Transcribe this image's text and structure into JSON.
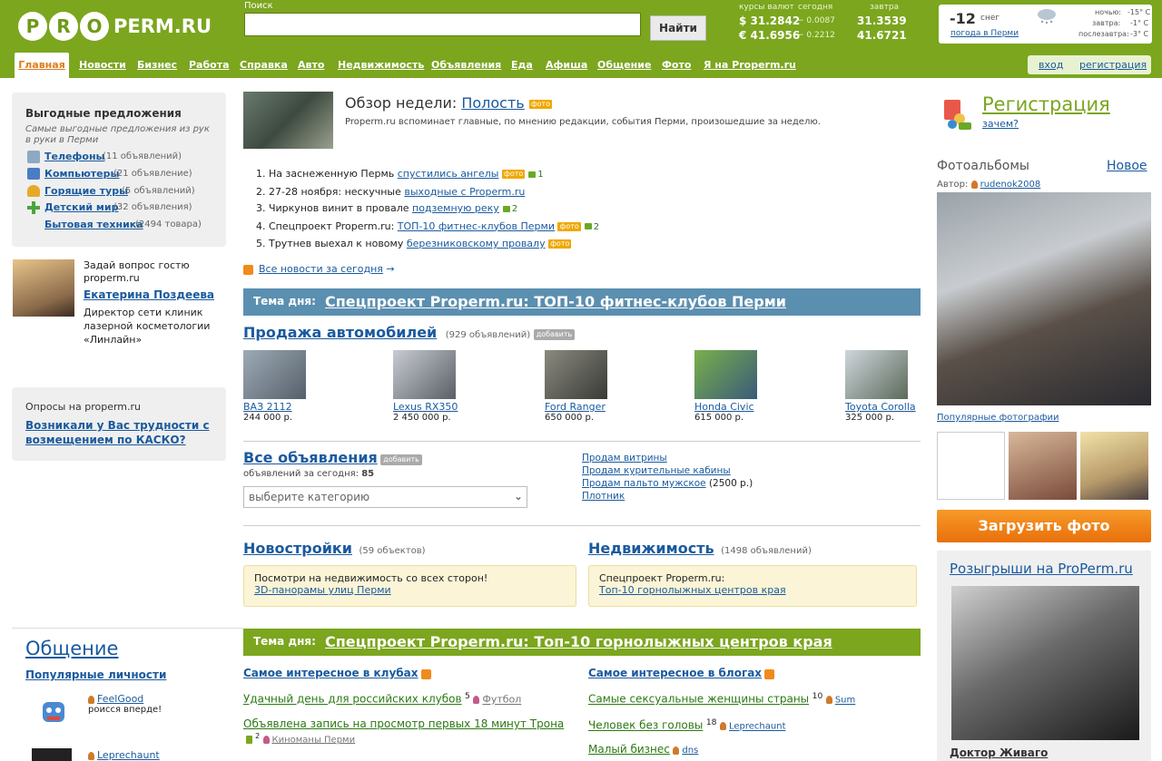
{
  "header": {
    "logo_letters": [
      "P",
      "R",
      "O"
    ],
    "logo_domain": "PERM.RU",
    "search_label": "Поиск",
    "search_button": "Найти",
    "currency": {
      "head_rates": "курсы валют",
      "head_today": "сегодня",
      "head_tomorrow": "завтра",
      "rows": [
        {
          "cur": "$ 31.2842",
          "chg": "− 0.0087",
          "tomorrow": "31.3539"
        },
        {
          "cur": "€ 41.6956",
          "chg": "− 0.2212",
          "tomorrow": "41.6721"
        }
      ]
    },
    "weather": {
      "temp": "-12",
      "desc": "снег",
      "link": "погода в Перми",
      "rows": [
        {
          "label": "ночью:",
          "val": "-15° C"
        },
        {
          "label": "завтра:",
          "val": "-1° C"
        },
        {
          "label": "послезавтра:",
          "val": "-3° C"
        }
      ]
    }
  },
  "nav": {
    "items": [
      "Главная",
      "Новости",
      "Бизнес",
      "Работа",
      "Справка",
      "Авто",
      "Недвижимость",
      "Объявления",
      "Еда",
      "Афиша",
      "Общение",
      "Фото",
      "Я на Properm.ru"
    ],
    "login": "вход",
    "register": "регистрация"
  },
  "left": {
    "offers_title": "Выгодные предложения",
    "offers_sub": "Самые выгодные предложения из рук в руки в Перми",
    "offers": [
      {
        "label": "Телефоны",
        "count": "(11 объявлений)"
      },
      {
        "label": "Компьютеры",
        "count": "(21 объявление)"
      },
      {
        "label": "Горящие туры",
        "count": "(5 объявлений)"
      },
      {
        "label": "Детский мир",
        "count": "(32 объявления)"
      },
      {
        "label": "Бытовая техника",
        "count": "(2494 товара)"
      }
    ],
    "guest_q": "Задай вопрос гостю properm.ru",
    "guest_name": "Екатерина Поздеева",
    "guest_desc": "Директор сети клиник лазерной косметологии «Линлайн»",
    "poll_title": "Опросы на properm.ru",
    "poll_q": "Возникали у Вас трудности с возмещением по КАСКО?"
  },
  "review": {
    "title": "Обзор недели:",
    "link": "Полость",
    "foto": "фото",
    "text": "Properm.ru вспоминает главные, по мнению редакции, события Перми, произошедшие за неделю.",
    "items": [
      {
        "pre": "1. На заснеженную Пермь ",
        "link": "спустились ангелы",
        "foto": "фото",
        "cmt": "1"
      },
      {
        "pre": "2. 27-28 ноября: нескучные ",
        "link": "выходные с Properm.ru",
        "foto": "",
        "cmt": ""
      },
      {
        "pre": "3. Чиркунов винит в провале ",
        "link": "подземную реку",
        "foto": "",
        "cmt": "2"
      },
      {
        "pre": "4. Спецпроект Properm.ru: ",
        "link": "ТОП-10 фитнес-клубов Перми",
        "foto": "фото",
        "cmt": "2"
      },
      {
        "pre": "5. Трутнев выехал к новому ",
        "link": "березниковскому провалу",
        "foto": "фото",
        "cmt": ""
      }
    ],
    "all_news": "Все новости за сегодня"
  },
  "theme1": {
    "label": "Тема дня:",
    "link": "Спецпроект Properm.ru: ТОП-10 фитнес-клубов Перми"
  },
  "cars": {
    "title": "Продажа автомобилей",
    "count": "(929 объявлений)",
    "add": "добавить",
    "items": [
      {
        "name": "ВАЗ 2112",
        "price": "244 000 р."
      },
      {
        "name": "Lexus RX350",
        "price": "2 450 000 р."
      },
      {
        "name": "Ford Ranger",
        "price": "650 000 р."
      },
      {
        "name": "Honda Civic",
        "price": "615 000 р."
      },
      {
        "name": "Toyota Corolla",
        "price": "325 000 р."
      }
    ]
  },
  "ads": {
    "title": "Все объявления",
    "add": "добавить",
    "today_label": "объявлений за сегодня:",
    "today_count": "85",
    "select": "выберите категорию",
    "links": [
      {
        "t": "Продам витрины",
        "x": ""
      },
      {
        "t": "Продам курительные кабины",
        "x": ""
      },
      {
        "t": "Продам пальто мужское",
        "x": "(2500 р.)"
      },
      {
        "t": "Плотник",
        "x": ""
      }
    ]
  },
  "newb": {
    "title": "Новостройки",
    "count": "(59 объектов)",
    "box_text": "Посмотри на недвижимость со всех сторон!",
    "box_link": "3D-панорамы улиц Перми"
  },
  "realty": {
    "title": "Недвижимость",
    "count": "(1498 объявлений)",
    "box_text": "Спецпроект Properm.ru:",
    "box_link": "Топ-10 горнолыжных центров края"
  },
  "theme2": {
    "label": "Тема дня:",
    "link": "Спецпроект Properm.ru: Топ-10 горнолыжных центров края"
  },
  "social": {
    "title": "Общение",
    "pop": "Популярные личности",
    "p1_name": "FeelGood",
    "p1_text": "роисся вперде!",
    "p2_name": "Leprechaunt"
  },
  "clubs": {
    "title": "Самое интересное в клубах",
    "items": [
      {
        "t": "Удачный день для российских клубов",
        "n": "5",
        "u": "Футбол"
      },
      {
        "t": "Объявлена запись на просмотр первых 18 минут Трона",
        "n": "2",
        "u": "Киноманы Перми"
      }
    ]
  },
  "blogs": {
    "title": "Самое интересное в блогах",
    "items": [
      {
        "t": "Самые сексуальные женщины страны",
        "n": "10",
        "u": "Sum"
      },
      {
        "t": "Человек без головы",
        "n": "18",
        "u": "Leprechaunt"
      },
      {
        "t": "Малый бизнес",
        "n": "",
        "u": "dns"
      }
    ]
  },
  "right": {
    "reg": "Регистрация",
    "why": "зачем?",
    "albums": "Фотоальбомы",
    "new": "Новое",
    "author_label": "Автор:",
    "author": "rudenok2008",
    "popular": "Популярные фотографии",
    "upload": "Загрузить фото",
    "contest": "Розыгрыши на ProPerm.ru",
    "contest_caption": "Доктор Живаго"
  },
  "colors": {
    "green": "#7ba61e",
    "blue_band": "#5b8fb0",
    "orange": "#f07a10"
  }
}
